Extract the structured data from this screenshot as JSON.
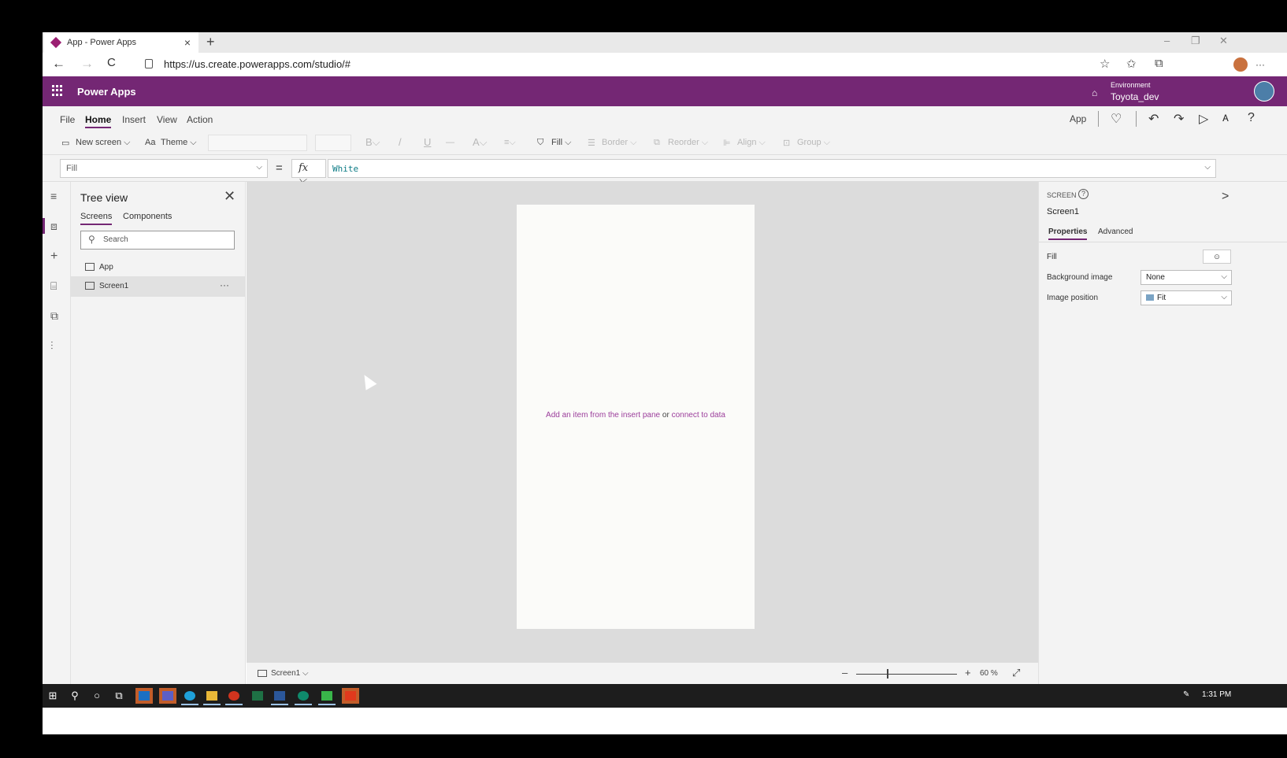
{
  "browser": {
    "tab_title": "App - Power Apps",
    "tab_close": "×",
    "new_tab": "+",
    "url": "https://us.create.powerapps.com/studio/#",
    "win_min": "–",
    "win_max": "❐",
    "win_close": "✕",
    "back": "←",
    "forward": "→",
    "reload": "C",
    "fav_add": "☆",
    "favorites": "✩",
    "collections": "⧉",
    "more": "···"
  },
  "header": {
    "app_name": "Power Apps",
    "environment_label": "Environment",
    "environment_name": "Toyota_dev",
    "accent_color": "#742774"
  },
  "menu": {
    "items": [
      {
        "label": "File"
      },
      {
        "label": "Home"
      },
      {
        "label": "Insert"
      },
      {
        "label": "View"
      },
      {
        "label": "Action"
      }
    ],
    "active": "Home",
    "app_label": "App",
    "checker": "♡",
    "undo": "↶",
    "redo": "↷",
    "play": "▷",
    "share": "ᴀ",
    "help": "?"
  },
  "ribbon": {
    "new_screen": "New screen ⌵",
    "theme": "Theme ⌵",
    "bold": "B⌵",
    "italic": "/",
    "underline": "U",
    "strike": "—",
    "font_color": "A⌵",
    "align": "≡⌵",
    "fill": "Fill ⌵",
    "border": "Border ⌵",
    "reorder": "Reorder ⌵",
    "align_ctl": "Align ⌵",
    "group": "Group ⌵"
  },
  "formula": {
    "property": "Fill",
    "equals": "=",
    "fx": "fx ⌵",
    "value": "White",
    "chevron": "⌵"
  },
  "tree": {
    "title": "Tree view",
    "close": "✕",
    "tabs": [
      {
        "label": "Screens"
      },
      {
        "label": "Components"
      }
    ],
    "search_placeholder": "Search",
    "items": [
      {
        "label": "App"
      },
      {
        "label": "Screen1"
      }
    ],
    "more": "···"
  },
  "canvas": {
    "hint_insert": "Add an item from the insert pane",
    "hint_or": "or",
    "hint_connect": "connect to data"
  },
  "status": {
    "screen": "Screen1 ⌵",
    "zoom_minus": "–",
    "zoom_plus": "+",
    "zoom": "60 %",
    "expand": "⤢",
    "zoom_level_percent": 60
  },
  "properties": {
    "kind": "SCREEN",
    "help": "?",
    "collapse": ">",
    "name": "Screen1",
    "tabs": [
      {
        "label": "Properties"
      },
      {
        "label": "Advanced"
      }
    ],
    "rows": [
      {
        "label": "Fill"
      },
      {
        "label": "Background image",
        "value": "None"
      },
      {
        "label": "Image position",
        "value": "Fit"
      }
    ],
    "fill_icon": "⊙"
  },
  "taskbar": {
    "time": "1:31 PM"
  }
}
